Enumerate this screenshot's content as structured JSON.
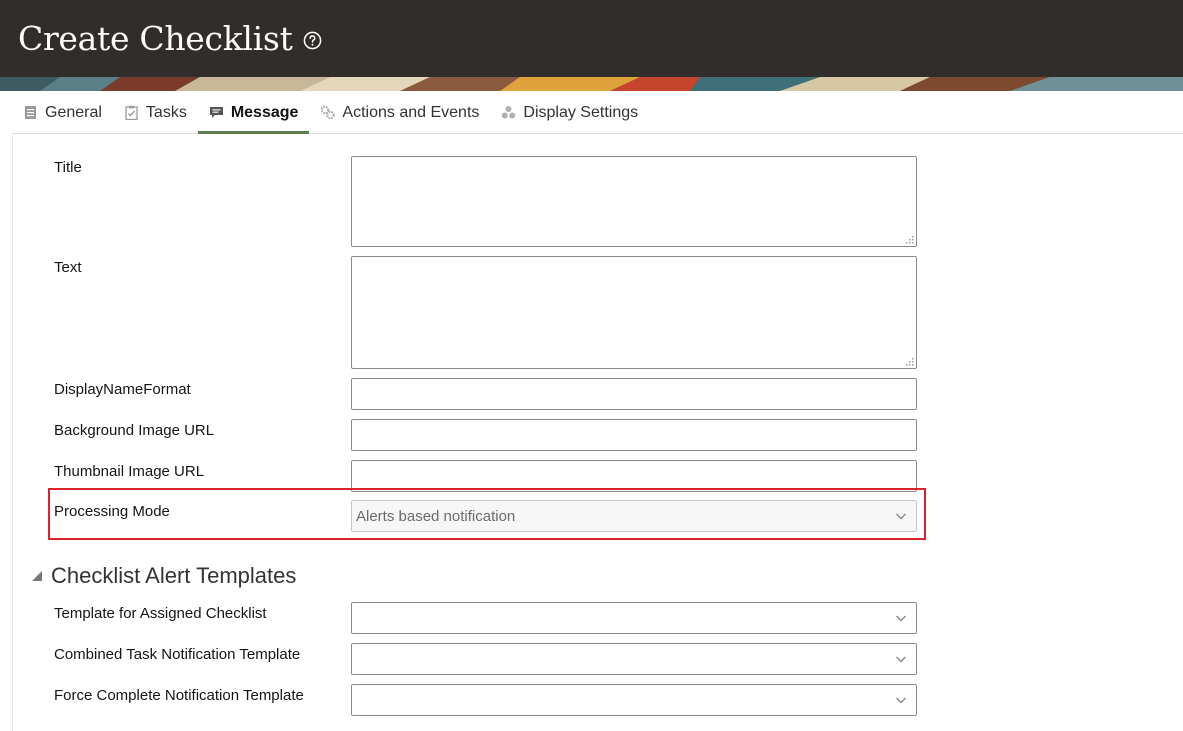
{
  "header": {
    "title": "Create Checklist",
    "help_icon": "help-circle-icon"
  },
  "tabs": [
    {
      "label": "General",
      "icon": "document-icon"
    },
    {
      "label": "Tasks",
      "icon": "clipboard-check-icon"
    },
    {
      "label": "Message",
      "icon": "chat-bubble-icon",
      "active": true
    },
    {
      "label": "Actions and Events",
      "icon": "gears-icon"
    },
    {
      "label": "Display Settings",
      "icon": "dots-cluster-icon"
    }
  ],
  "form": {
    "title_label": "Title",
    "title_value": "",
    "text_label": "Text",
    "text_value": "",
    "display_name_format_label": "DisplayNameFormat",
    "display_name_format_value": "",
    "background_image_url_label": "Background Image URL",
    "background_image_url_value": "",
    "thumbnail_image_url_label": "Thumbnail Image URL",
    "thumbnail_image_url_value": "",
    "processing_mode_label": "Processing Mode",
    "processing_mode_value": "Alerts based notification"
  },
  "alert_templates": {
    "section_title": "Checklist Alert Templates",
    "assigned_label": "Template for Assigned Checklist",
    "assigned_value": "",
    "combined_label": "Combined Task Notification Template",
    "combined_value": "",
    "force_label": "Force Complete Notification Template",
    "force_value": ""
  },
  "colors": {
    "header_bg": "#312d2a",
    "active_tab_underline": "#5f7d4f",
    "highlight_border": "#d9242a"
  }
}
